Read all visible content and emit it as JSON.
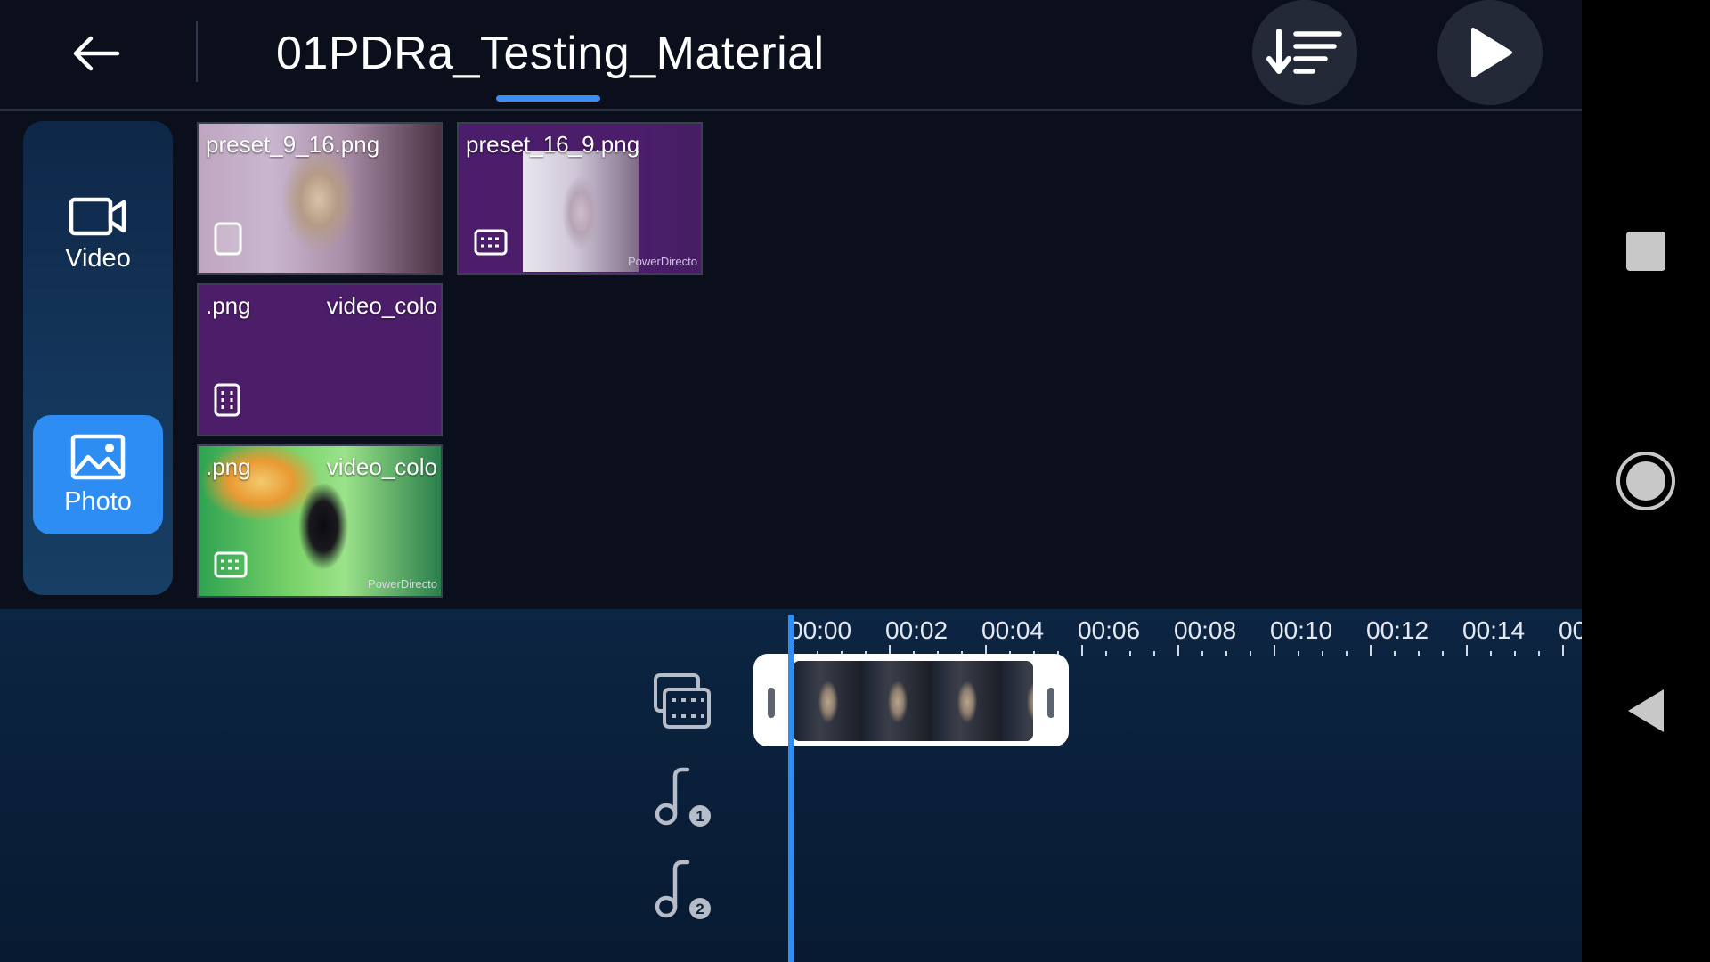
{
  "header": {
    "title": "01PDRa_Testing_Material"
  },
  "media_types": [
    {
      "label": "Video",
      "icon": "video-camera-icon",
      "selected": false
    },
    {
      "label": "Photo",
      "icon": "image-icon",
      "selected": true
    }
  ],
  "thumbnails": [
    {
      "name": "preset_9_16.png",
      "badge": "portrait-ratio-icon"
    },
    {
      "name": "preset_16_9.png",
      "badge": "landscape-ratio-icon",
      "watermark": "PowerDirecto"
    },
    {
      "name": ".png",
      "name2": "video_colo",
      "badge": "portrait-ratio-icon"
    },
    {
      "name": ".png",
      "name2": "video_colo",
      "badge": "landscape-ratio-icon",
      "watermark": "PowerDirecto"
    }
  ],
  "timeline": {
    "ruler_labels": [
      "00:00",
      "00:02",
      "00:04",
      "00:06",
      "00:08",
      "00:10",
      "00:12",
      "00:14",
      "00"
    ],
    "tracks": [
      {
        "icon": "video-track-icon"
      },
      {
        "icon": "music-track-1-icon",
        "number": "1"
      },
      {
        "icon": "music-track-2-icon",
        "number": "2"
      }
    ]
  },
  "colors": {
    "accent": "#2e8df3",
    "background": "#0b0f1c",
    "timeline_bg": "#0a2240"
  }
}
